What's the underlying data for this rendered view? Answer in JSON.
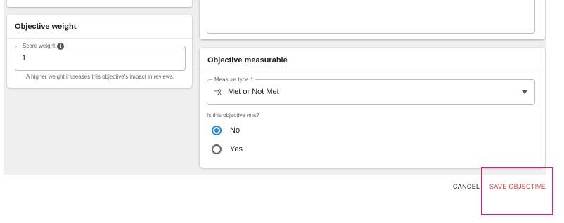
{
  "objective_weight": {
    "title": "Objective weight",
    "score_field": {
      "label": "Score weight",
      "value": "1"
    },
    "helper": "A higher weight increases this objective's impact in reviews."
  },
  "objective_measurable": {
    "title": "Objective measurable",
    "measure_type": {
      "label": "Measure type",
      "required_mark": "*",
      "value": "Met or Not Met"
    },
    "question": "Is this objective met?",
    "options": [
      {
        "label": "No",
        "selected": true
      },
      {
        "label": "Yes",
        "selected": false
      }
    ]
  },
  "footer": {
    "cancel_label": "CANCEL",
    "save_label": "SAVE OBJECTIVE"
  },
  "colors": {
    "accent": "#1e88e5",
    "save": "#e53935",
    "highlight": "#b0327a"
  }
}
